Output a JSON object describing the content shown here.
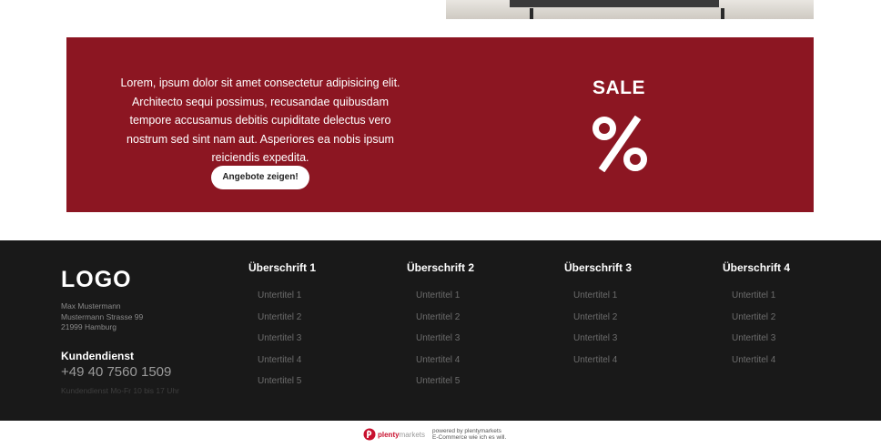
{
  "banner": {
    "text": "Lorem, ipsum dolor sit amet consectetur adipisicing elit. Architecto sequi possimus, recusandae quibusdam tempore accusamus debitis cupiditate delectus vero nostrum sed sint nam aut. Asperiores ea nobis ipsum reiciendis expedita.",
    "button_label": "Angebote zeigen!",
    "sale_title": "SALE",
    "sale_icon": "percent-icon",
    "color": "#8c1622"
  },
  "footer": {
    "logo": "LOGO",
    "address": [
      "Max Mustermann",
      "Mustermann Strasse 99",
      "21999 Hamburg"
    ],
    "service": {
      "title": "Kundendienst",
      "phone": "+49 40 7560 1509",
      "hours": "Kundendienst Mo-Fr 10 bis 17 Uhr"
    },
    "columns": [
      {
        "title": "Überschrift 1",
        "items": [
          "Untertitel 1",
          "Untertitel 2",
          "Untertitel 3",
          "Untertitel 4",
          "Untertitel 5"
        ]
      },
      {
        "title": "Überschrift 2",
        "items": [
          "Untertitel 1",
          "Untertitel 2",
          "Untertitel 3",
          "Untertitel 4",
          "Untertitel 5"
        ]
      },
      {
        "title": "Überschrift 3",
        "items": [
          "Untertitel 1",
          "Untertitel 2",
          "Untertitel 3",
          "Untertitel 4"
        ]
      },
      {
        "title": "Überschrift 4",
        "items": [
          "Untertitel 1",
          "Untertitel 2",
          "Untertitel 3",
          "Untertitel 4"
        ]
      }
    ]
  },
  "powered": {
    "brand": "plenty",
    "brand_suffix": "markets",
    "line1": "powered by plentymarkets",
    "line2": "E-Commerce wie ich es will."
  }
}
